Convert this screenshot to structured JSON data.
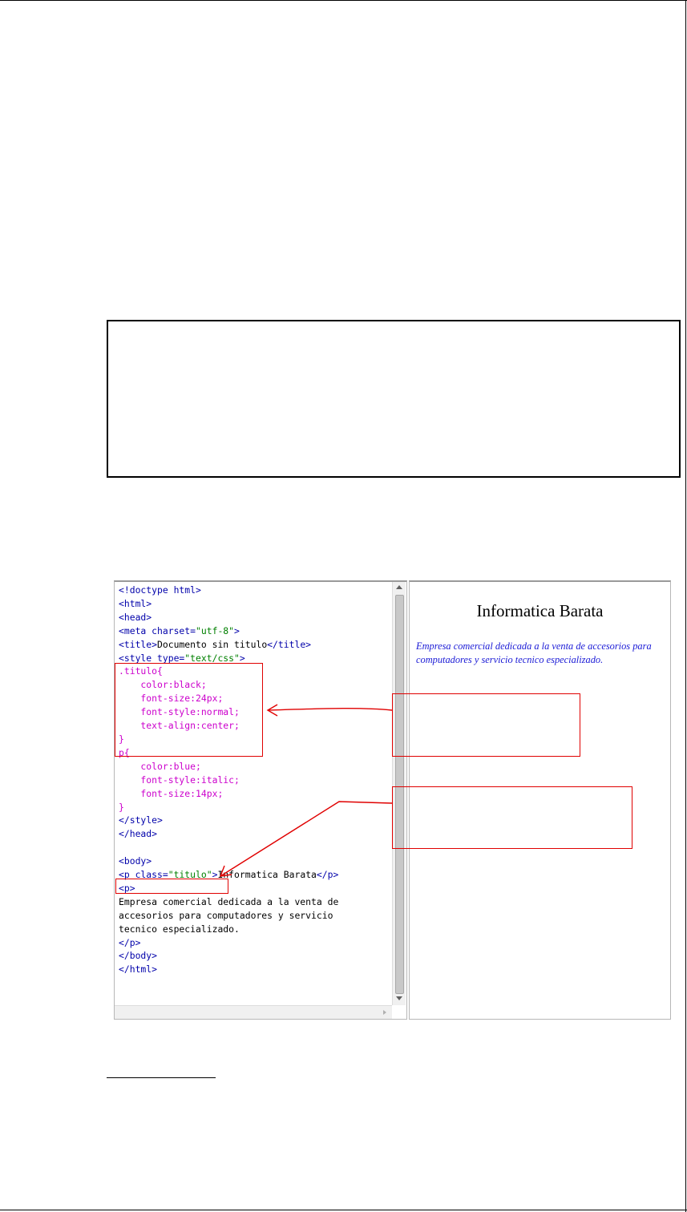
{
  "code_editor": {
    "lines": [
      "<!doctype html>",
      "<html>",
      "<head>",
      "<meta charset=\"utf-8\">",
      "<title>Documento sin titulo</title>",
      "<style type=\"text/css\">",
      ".titulo{",
      "    color:black;",
      "    font-size:24px;",
      "    font-style:normal;",
      "    text-align:center;",
      "}",
      "p{",
      "    color:blue;",
      "    font-style:italic;",
      "    font-size:14px;",
      "}",
      "</style>",
      "</head>",
      "",
      "<body>",
      "<p class=\"titulo\">Informatica Barata</p>",
      "<p>",
      "Empresa comercial dedicada a la venta de",
      "accesorios para computadores y servicio",
      "tecnico especializado.",
      "</p>",
      "</body>",
      "</html>"
    ]
  },
  "preview": {
    "title": "Informatica Barata",
    "paragraph": "Empresa comercial dedicada a la venta de accesorios para computadores y servicio tecnico especializado."
  },
  "colors": {
    "html_tag": "#0000aa",
    "css_rule": "#cc00cc",
    "attribute_string": "#008000",
    "annotation": "#e00000",
    "preview_paragraph": "#1a1ad6"
  }
}
